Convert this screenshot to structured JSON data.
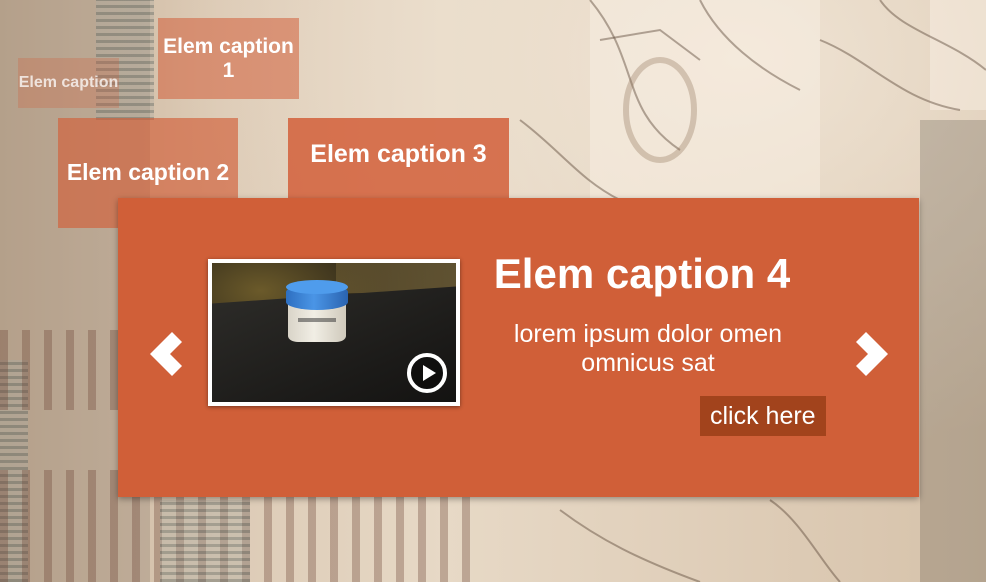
{
  "captions": [
    {
      "text": "Elem caption"
    },
    {
      "text": "Elem caption 1"
    },
    {
      "text": "Elem caption 2"
    },
    {
      "text": "Elem caption 3"
    }
  ],
  "slide": {
    "title": "Elem caption 4",
    "description": "lorem ipsum dolor omen omnicus sat",
    "button_label": "click here",
    "thumbnail_icon": "play-icon",
    "prev_icon": "chevron-left-icon",
    "next_icon": "chevron-right-icon"
  },
  "colors": {
    "accent": "#d05f38",
    "button": "#a2431c",
    "text": "#ffffff"
  }
}
